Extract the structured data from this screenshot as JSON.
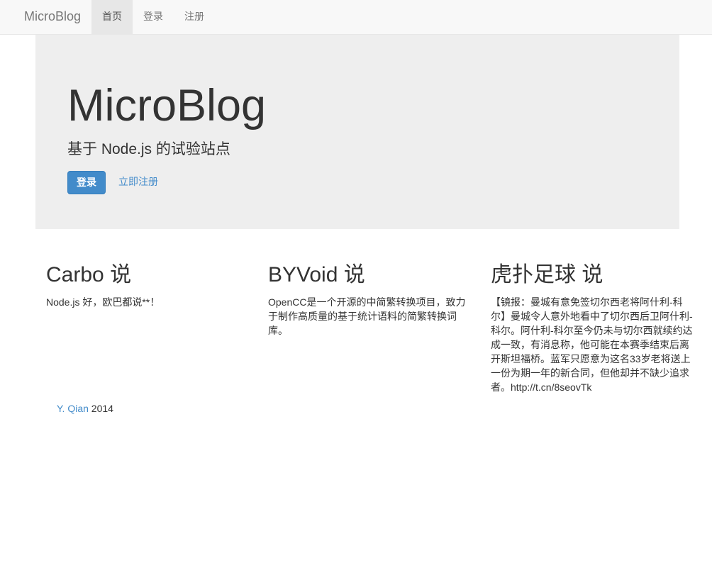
{
  "navbar": {
    "brand": "MicroBlog",
    "items": [
      {
        "label": "首页",
        "active": true
      },
      {
        "label": "登录",
        "active": false
      },
      {
        "label": "注册",
        "active": false
      }
    ]
  },
  "jumbotron": {
    "title": "MicroBlog",
    "subtitle": "基于 Node.js 的试验站点",
    "login_button": "登录",
    "register_link": "立即注册"
  },
  "posts": [
    {
      "author": "Carbo",
      "says": "说",
      "content": "Node.js 好，欧巴都说**！"
    },
    {
      "author": "BYVoid",
      "says": "说",
      "content": "OpenCC是一个开源的中简繁转换项目，致力于制作高质量的基于统计语料的简繁转换词库。"
    },
    {
      "author": "虎扑足球",
      "says": "说",
      "content": "【镜报：曼城有意免签切尔西老将阿什利-科尔】曼城令人意外地看中了切尔西后卫阿什利-科尔。阿什利-科尔至今仍未与切尔西就续约达成一致，有消息称，他可能在本赛季结束后离开斯坦福桥。蓝军只愿意为这名33岁老将送上一份为期一年的新合同，但他却并不缺少追求者。http://t.cn/8seovTk"
    }
  ],
  "footer": {
    "author_link": "Y. Qian",
    "year": "2014"
  },
  "colors": {
    "accent": "#428bca",
    "navbar_bg": "#f8f8f8",
    "jumbotron_bg": "#eeeeee"
  }
}
